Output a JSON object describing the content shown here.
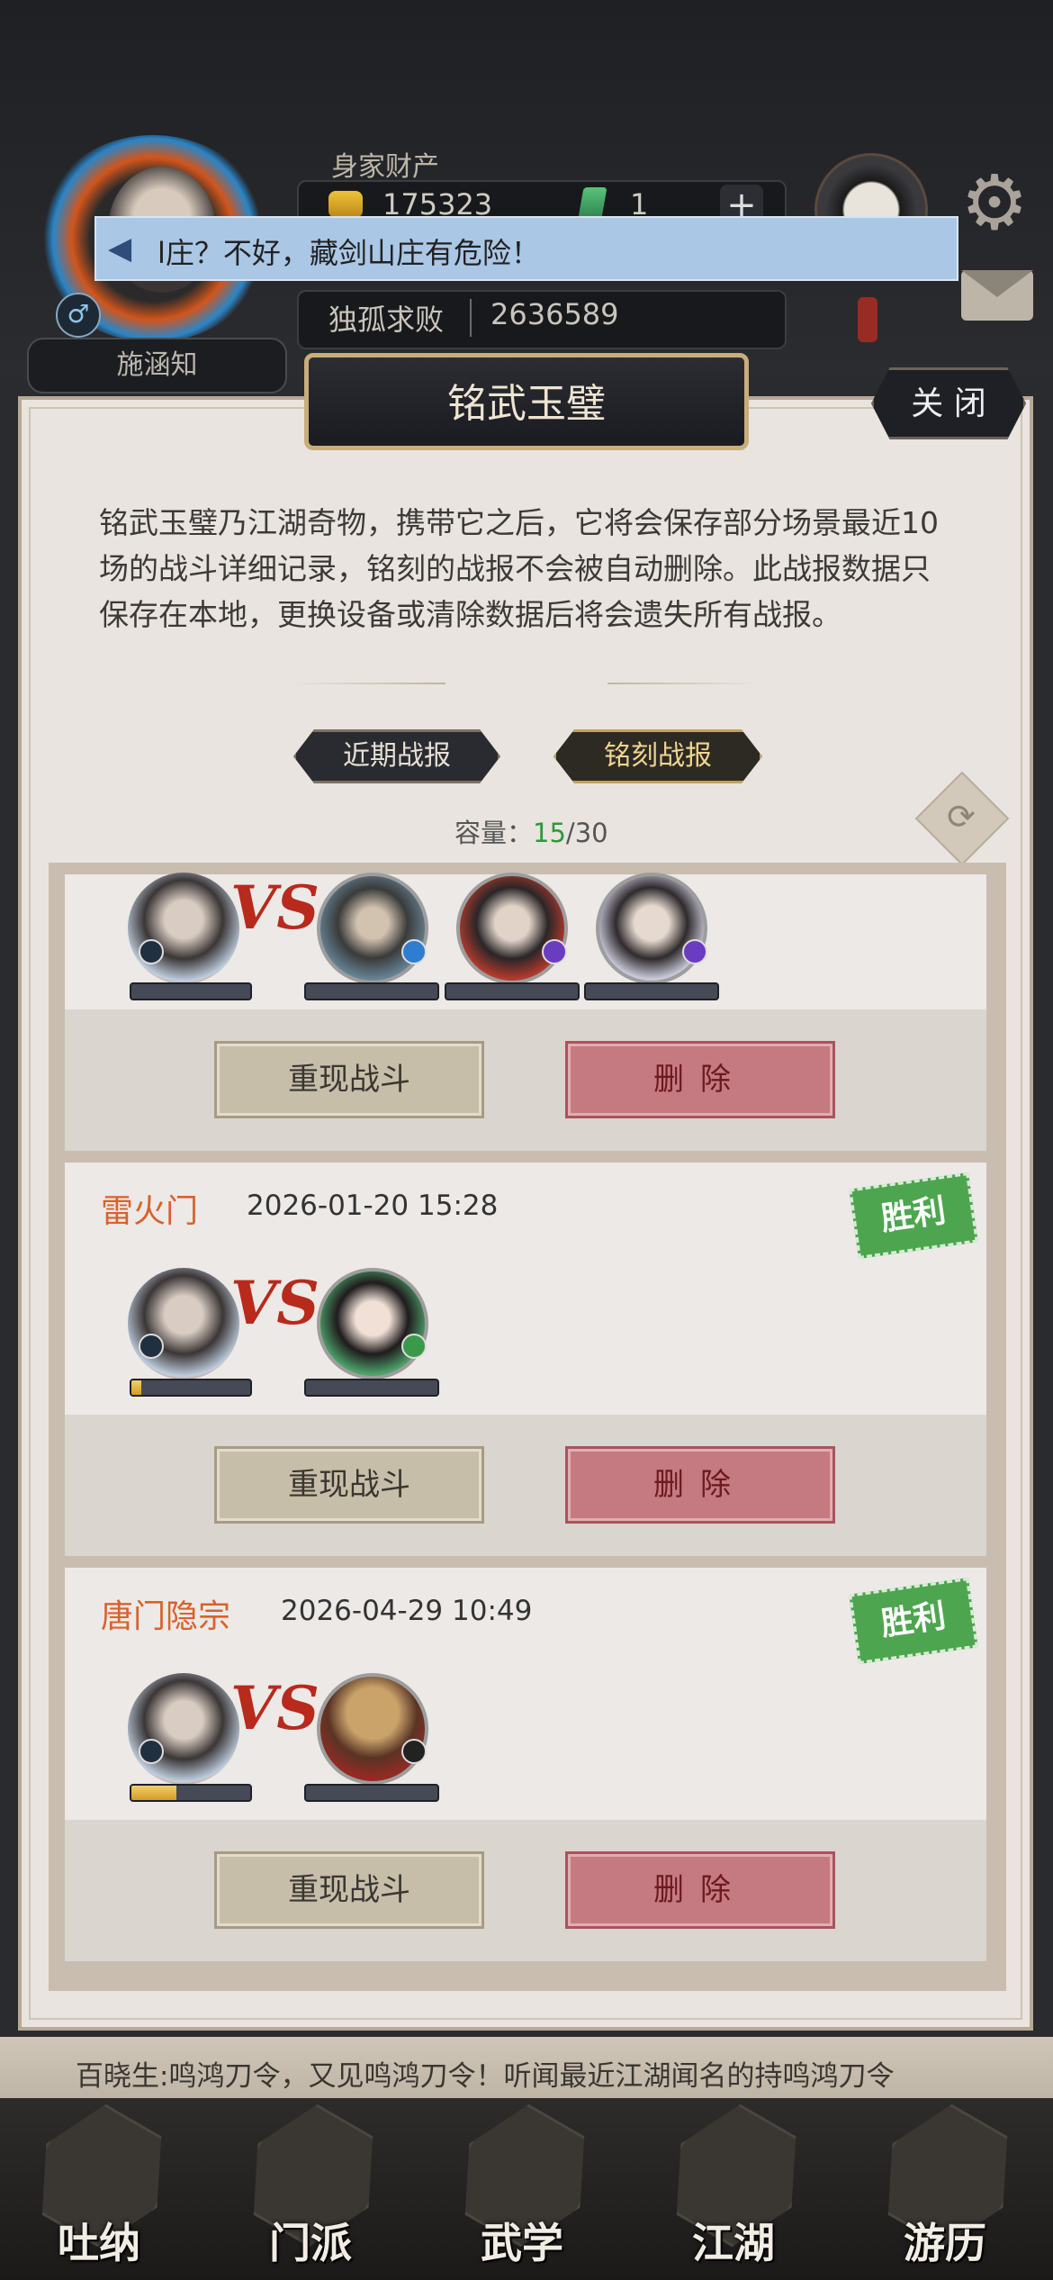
{
  "header": {
    "wealth_label": "身家财产",
    "gold": "175323",
    "jade": "1",
    "add_symbol": "+",
    "title": "独孤求败",
    "power": "2636589",
    "player_name": "施涵知",
    "gender_symbol": "♂"
  },
  "announcement": {
    "icon": "megaphone-icon",
    "text": "l庄？不好，藏剑山庄有危险！"
  },
  "panel": {
    "title": "铭武玉璧",
    "close_label": "关 闭",
    "description": "铭武玉璧乃江湖奇物，携带它之后，它将会保存部分场景最近10场的战斗详细记录，铭刻的战报不会被自动删除。此战报数据只保存在本地，更换设备或清除数据后将会遗失所有战报。",
    "tabs": [
      {
        "label": "近期战报",
        "active": false
      },
      {
        "label": "铭刻战报",
        "active": true
      }
    ],
    "capacity_label": "容量：",
    "capacity_used": "15",
    "capacity_total": "/30"
  },
  "records": [
    {
      "sect": "",
      "time": "",
      "result": "",
      "enemies": 3,
      "hp_fraction": 0.0,
      "replay_label": "重现战斗",
      "delete_label": "删除"
    },
    {
      "sect": "雷火门",
      "time": "2026-01-20 15:28",
      "result": "胜利",
      "enemies": 1,
      "hp_fraction": 0.08,
      "replay_label": "重现战斗",
      "delete_label": "删除"
    },
    {
      "sect": "唐门隐宗",
      "time": "2026-04-29 10:49",
      "result": "胜利",
      "enemies": 1,
      "hp_fraction": 0.38,
      "replay_label": "重现战斗",
      "delete_label": "删除"
    }
  ],
  "vs_label": "VS",
  "news": "百晓生:鸣鸿刀令，又见鸣鸿刀令！听闻最近江湖闻名的持鸣鸿刀令",
  "nav": [
    {
      "label": "吐纳",
      "icon": "meditation-icon"
    },
    {
      "label": "门派",
      "icon": "sect-icon"
    },
    {
      "label": "武学",
      "icon": "martial-book-icon"
    },
    {
      "label": "江湖",
      "icon": "jianghu-hat-icon"
    },
    {
      "label": "游历",
      "icon": "travel-horse-icon"
    }
  ],
  "colors": {
    "accent_gold": "#c9ad7a",
    "victory_green": "#4da64f",
    "delete_red": "#c47a80",
    "capacity_green": "#2b9a3a"
  }
}
